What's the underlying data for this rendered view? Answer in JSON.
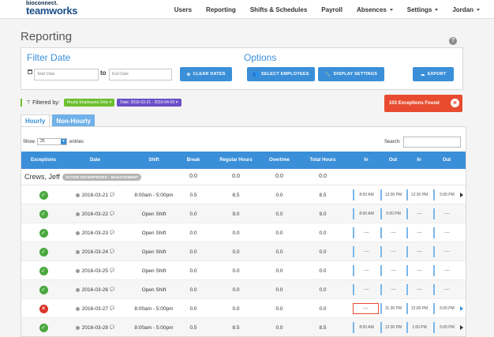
{
  "nav": {
    "logo_top": "bioconnect.",
    "logo_bottom": "teamworks",
    "items": [
      {
        "label": "Users",
        "dropdown": false
      },
      {
        "label": "Reporting",
        "dropdown": false
      },
      {
        "label": "Shifts & Schedules",
        "dropdown": false
      },
      {
        "label": "Payroll",
        "dropdown": false
      },
      {
        "label": "Absences",
        "dropdown": true
      },
      {
        "label": "Settings",
        "dropdown": true
      },
      {
        "label": "Jordan",
        "dropdown": true
      }
    ]
  },
  "page": {
    "title": "Reporting",
    "help": "?"
  },
  "filter_date": {
    "title": "Filter Date",
    "start_placeholder": "Start Date",
    "to_label": "to",
    "end_placeholder": "End Date",
    "clear_label": "CLEAR DATES"
  },
  "options": {
    "title": "Options",
    "select_label": "SELECT EMPLOYEES",
    "display_label": "DISPLAY SETTINGS",
    "export_label": "EXPORT"
  },
  "filtered": {
    "label": "Filtered by:",
    "chips": [
      {
        "text": "Hourly Employees Only",
        "color": "#6cbf2e"
      },
      {
        "text": "Date: 2016-03-21 - 2016-04-03",
        "color": "#6b4fc8"
      }
    ]
  },
  "exceptions": {
    "label": "103 Exceptions Found",
    "color": "#e84b2f"
  },
  "tabs": [
    {
      "label": "Hourly",
      "active": true
    },
    {
      "label": "Non-Hourly",
      "active": false
    }
  ],
  "table": {
    "show_label": "Show",
    "page_size": "25",
    "entries_label": "entries",
    "search_label": "Search:",
    "headers": [
      "Exceptions",
      "Date",
      "Shift",
      "Break",
      "Regular Hours",
      "Overtime",
      "Total Hours",
      "In",
      "Out",
      "In",
      "Out"
    ],
    "group": {
      "name": "Crews, Jeff",
      "badge": "ACTIVE ENTERPRISES - MANAGEMENT",
      "break": "0.0",
      "regular": "0.0",
      "overtime": "0.0",
      "total": "0.0"
    },
    "rows": [
      {
        "status": "ok",
        "date": "2016-03-21",
        "shift": "8:00am - 5:00pm",
        "break": "0.5",
        "regular": "8.5",
        "overtime": "0.0",
        "total": "8.5",
        "in1": "8:00 AM",
        "out1": "12:00 PM",
        "in2": "12:30 PM",
        "out2": "5:00 PM",
        "err": false,
        "more": true
      },
      {
        "status": "ok",
        "date": "2016-03-22",
        "shift": "Open Shift",
        "break": "0.0",
        "regular": "9.0",
        "overtime": "0.0",
        "total": "9.0",
        "in1": "8:00 AM",
        "out1": "5:00 PM",
        "in2": "----",
        "out2": "----",
        "err": false,
        "more": false
      },
      {
        "status": "ok",
        "date": "2016-03-23",
        "shift": "Open Shift",
        "break": "0.0",
        "regular": "0.0",
        "overtime": "0.0",
        "total": "0.0",
        "in1": "----",
        "out1": "----",
        "in2": "----",
        "out2": "----",
        "err": false,
        "more": false
      },
      {
        "status": "ok",
        "date": "2016-03-24",
        "shift": "Open Shift",
        "break": "0.0",
        "regular": "0.0",
        "overtime": "0.0",
        "total": "0.0",
        "in1": "----",
        "out1": "----",
        "in2": "----",
        "out2": "----",
        "err": false,
        "more": false
      },
      {
        "status": "ok",
        "date": "2016-03-25",
        "shift": "Open Shift",
        "break": "0.0",
        "regular": "0.0",
        "overtime": "0.0",
        "total": "0.0",
        "in1": "----",
        "out1": "----",
        "in2": "----",
        "out2": "----",
        "err": false,
        "more": false
      },
      {
        "status": "ok",
        "date": "2016-03-26",
        "shift": "Open Shift",
        "break": "0.0",
        "regular": "0.0",
        "overtime": "0.0",
        "total": "0.0",
        "in1": "----",
        "out1": "----",
        "in2": "----",
        "out2": "----",
        "err": false,
        "more": false
      },
      {
        "status": "bad",
        "date": "2016-03-27",
        "shift": "8:00am - 5:00pm",
        "break": "0.0",
        "regular": "0.0",
        "overtime": "0.0",
        "total": "0.0",
        "in1": "----",
        "out1": "11:30 PM",
        "in2": "12:00 PM",
        "out2": "5:00 PM",
        "err": true,
        "more": true
      },
      {
        "status": "ok",
        "date": "2016-03-28",
        "shift": "8:00am - 5:00pm",
        "break": "0.5",
        "regular": "8.5",
        "overtime": "0.0",
        "total": "8.5",
        "in1": "8:00 AM",
        "out1": "12:30 PM",
        "in2": "1:00 PM",
        "out2": "5:00 PM",
        "err": false,
        "more": true
      }
    ]
  },
  "colors": {
    "accent": "#3a8fd8",
    "success": "#4aa83f",
    "danger": "#d9352a"
  }
}
